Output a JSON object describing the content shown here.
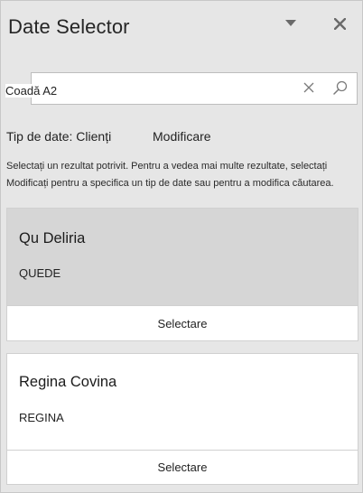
{
  "pane": {
    "title": "Date Selector",
    "icons": {
      "options": "chevron-down-icon",
      "close": "close-icon",
      "clear": "clear-icon",
      "search": "search-icon"
    }
  },
  "search": {
    "value": "Coadă A2"
  },
  "meta": {
    "data_type": "Tip de date: Clienți",
    "modify_label": "Modificare"
  },
  "help_text": "Selectați un rezultat potrivit. Pentru a vedea mai multe rezultate, selectați Modificați pentru a specifica un tip de date sau pentru a modifica căutarea.",
  "results": [
    {
      "name": "Qu Deliria",
      "code": "QUEDE",
      "action": "Selectare"
    },
    {
      "name": "Regina Covina",
      "code": "REGINA",
      "action": "Selectare"
    }
  ],
  "colors": {
    "pane_bg": "#e6e6e6",
    "selected_card_bg": "#d6d6d6",
    "card_bg": "#ffffff"
  }
}
